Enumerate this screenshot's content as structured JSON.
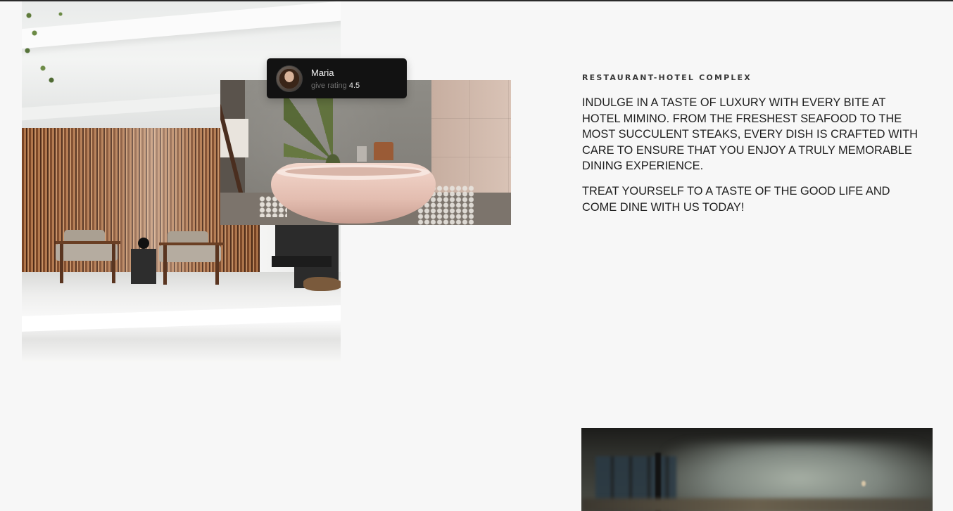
{
  "review": {
    "name": "Maria",
    "rating_label": "give rating",
    "rating_value": "4.5"
  },
  "section": {
    "eyebrow": "RESTAURANT-HOTEL COMPLEX",
    "paragraph_1": "INDULGE IN A TASTE OF LUXURY WITH EVERY BITE AT HOTEL MIMINO. FROM THE FRESHEST SEAFOOD TO THE MOST SUCCULENT STEAKS, EVERY DISH IS CRAFTED WITH CARE TO ENSURE THAT YOU ENJOY A TRULY MEMORABLE DINING EXPERIENCE.",
    "paragraph_2": "TREAT YOURSELF TO A TASTE OF THE GOOD LIFE AND COME DINE WITH US TODAY!"
  },
  "colors": {
    "page_background": "#f7f7f7",
    "review_card": "#121212",
    "text": "#1e1e1e"
  },
  "images": {
    "patio": "patio-photo",
    "bathroom": "bathroom-photo",
    "dining": "dining-photo"
  }
}
